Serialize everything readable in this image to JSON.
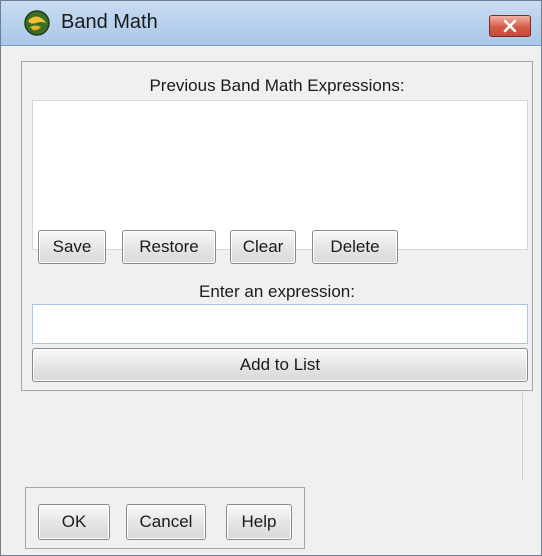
{
  "window": {
    "title": "Band Math",
    "close_label": "×"
  },
  "expressions": {
    "label": "Previous Band Math Expressions:",
    "items": []
  },
  "list_buttons": {
    "save": "Save",
    "restore": "Restore",
    "clear": "Clear",
    "delete": "Delete"
  },
  "entry": {
    "label": "Enter an expression:",
    "value": "",
    "placeholder": "",
    "add_label": "Add to List"
  },
  "footer": {
    "ok": "OK",
    "cancel": "Cancel",
    "help": "Help"
  }
}
